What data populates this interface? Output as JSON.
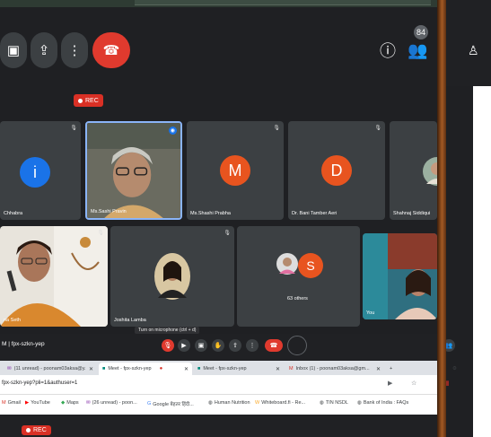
{
  "meeting": {
    "code": "fpx-szkn-yep",
    "rec_label": "REC",
    "participant_count": "84"
  },
  "participants": [
    {
      "name": "Chhabra",
      "initial": "i",
      "color": "#1a73e8"
    },
    {
      "name": "Ms.Sashi Pravin",
      "initial": "",
      "color": ""
    },
    {
      "name": "Ms.Shashi Prabha",
      "initial": "M",
      "color": "#e8541f"
    },
    {
      "name": "Dr. Bani Tamber Aeri",
      "initial": "D",
      "color": "#e8541f"
    },
    {
      "name": "Shahnaj Siddiqui",
      "initial": "",
      "color": ""
    },
    {
      "name": "na Seth",
      "initial": "",
      "color": ""
    },
    {
      "name": "Joshita Lamba",
      "initial": "",
      "color": ""
    },
    {
      "name": "63 others",
      "initial": "S",
      "color": "#e8541f"
    },
    {
      "name": "You",
      "initial": "",
      "color": ""
    }
  ],
  "tooltip": "Turn on microphone (ctrl + d)",
  "tabs": [
    {
      "label": "(11 unread) - poonam03aksa@y..."
    },
    {
      "label": "Meet - fpx-szkn-yep"
    },
    {
      "label": "Meet - fpx-szkn-yep"
    },
    {
      "label": "Inbox (1) - poonam03aksa@gm..."
    }
  ],
  "url": "fpx-szkn-yep?pli=1&authuser=1",
  "bookmarks": [
    "Gmail",
    "YouTube",
    "Maps",
    "(26 unread) - poon...",
    "Google बेहतर हिंदी...",
    "Human Nutrition",
    "Whiteboard.fi - Re...",
    "TIN NSDL",
    "Bank of India : FAQs"
  ]
}
